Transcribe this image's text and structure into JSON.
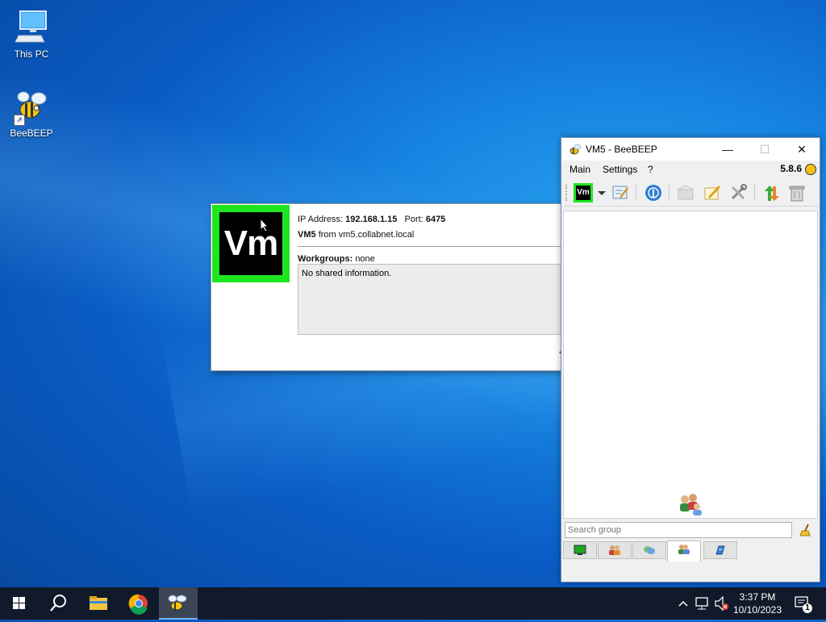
{
  "desktop": {
    "icons": [
      {
        "label": "This PC"
      },
      {
        "label": "BeeBEEP"
      }
    ]
  },
  "card": {
    "avatar_text": "Vm",
    "ip_label": "IP Address:",
    "ip_value": "192.168.1.15",
    "port_label": "Port:",
    "port_value": "6475",
    "user_name": "VM5",
    "from_text": "from vm5.collabnet.local",
    "workgroups_label": "Workgroups:",
    "workgroups_value": "none",
    "shared_info": "No shared information."
  },
  "window": {
    "title": "VM5 - BeeBEEP",
    "minimize": "—",
    "maximize": "☐",
    "close": "✕",
    "menu": [
      "Main",
      "Settings",
      "?"
    ],
    "version": "5.8.6",
    "status_button_text": "Vm",
    "search_placeholder": "Search group"
  },
  "taskbar": {
    "time": "3:37 PM",
    "date": "10/10/2023",
    "notification_count": "1"
  },
  "colors": {
    "avatar_border": "#1ee61e",
    "taskbar": "#101a2a",
    "desktop": "#1683e0"
  }
}
